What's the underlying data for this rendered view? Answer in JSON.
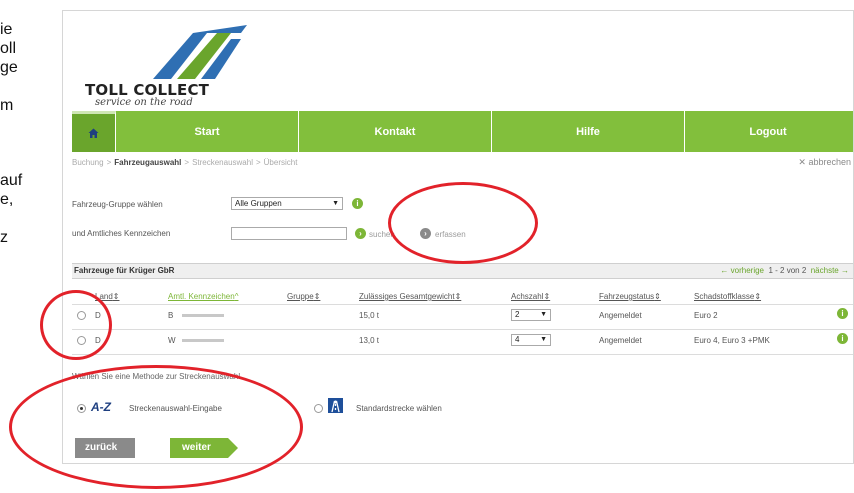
{
  "side_text": [
    "ie",
    "oll",
    "ge",
    "m",
    "auf",
    "e,",
    "z"
  ],
  "logo": {
    "title": "TOLL COLLECT",
    "subtitle": "service on the road"
  },
  "nav": {
    "items": [
      "Start",
      "Kontakt",
      "Hilfe",
      "Logout"
    ]
  },
  "breadcrumb": {
    "items": [
      "Buchung",
      "Fahrzeugauswahl",
      "Streckenauswahl",
      "Übersicht"
    ],
    "active_index": 1
  },
  "cancel_link": "abbrechen",
  "form": {
    "group_label": "Fahrzeug-Gruppe wählen",
    "group_value": "Alle Gruppen",
    "plate_label": "und Amtliches Kennzeichen",
    "plate_value": "",
    "search_label": "suchen",
    "register_label": "erfassen"
  },
  "table": {
    "title": "Fahrzeuge für Krüger GbR",
    "pager": {
      "prev": "vorherige",
      "range": "1 - 2 von 2",
      "next": "nächste"
    },
    "columns": [
      "Land",
      "Amtl. Kennzeichen",
      "Gruppe",
      "Zulässiges Gesamtgewicht",
      "Achszahl",
      "Fahrzeugstatus",
      "Schadstoffklasse"
    ],
    "rows": [
      {
        "land": "D",
        "plate": "B",
        "group": "",
        "weight": "15,0 t",
        "axles": "2",
        "status": "Angemeldet",
        "emission": "Euro 2"
      },
      {
        "land": "D",
        "plate": "W",
        "group": "",
        "weight": "13,0 t",
        "axles": "4",
        "status": "Angemeldet",
        "emission": "Euro 4, Euro 3 +PMK"
      }
    ]
  },
  "route": {
    "prompt": "Wählen Sie eine Methode zur Streckenauswahl",
    "option1_badge": "A-Z",
    "option1_label": "Streckenauswahl-Eingabe",
    "option2_label": "Standardstrecke wählen",
    "selected": "option1"
  },
  "buttons": {
    "back": "zurück",
    "next": "weiter"
  },
  "colors": {
    "nav_green": "#82bf3c",
    "nav_home": "#6aa52c",
    "highlight_red": "#e2222a",
    "back_gray": "#8a8a8a",
    "next_green": "#7db637"
  }
}
